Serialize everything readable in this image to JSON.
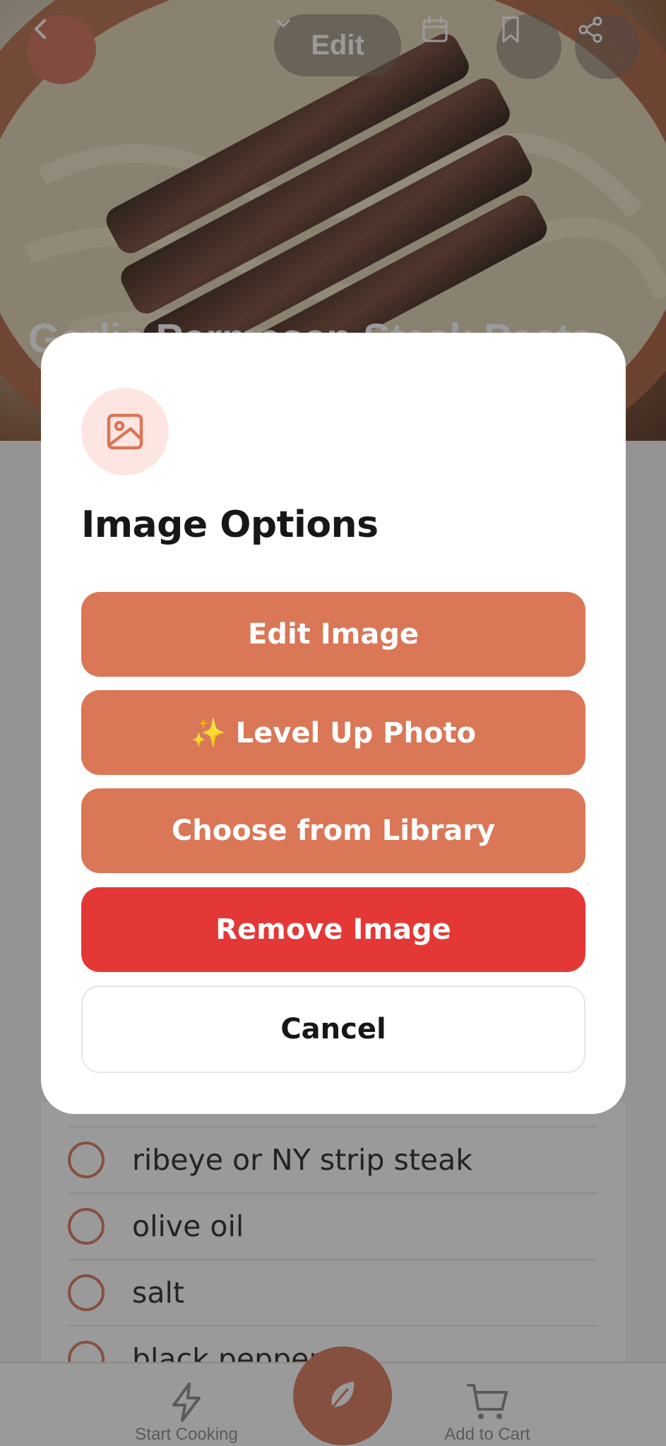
{
  "header": {
    "edit_label": "Edit",
    "recipe_title": "Garlic Parmesan Steak Pasta"
  },
  "ingredients": [
    {
      "name": "ribeye or NY strip steak"
    },
    {
      "name": "olive oil"
    },
    {
      "name": "salt"
    },
    {
      "name": "black pepper"
    }
  ],
  "bottom_nav": {
    "start_cooking": "Start Cooking",
    "add_to_cart": "Add to Cart"
  },
  "modal": {
    "title": "Image Options",
    "edit_image": "Edit Image",
    "level_up_photo": "✨ Level Up Photo",
    "choose_from_library": "Choose from Library",
    "remove_image": "Remove Image",
    "cancel": "Cancel"
  },
  "colors": {
    "accent": "#d97757",
    "danger": "#e43837"
  }
}
